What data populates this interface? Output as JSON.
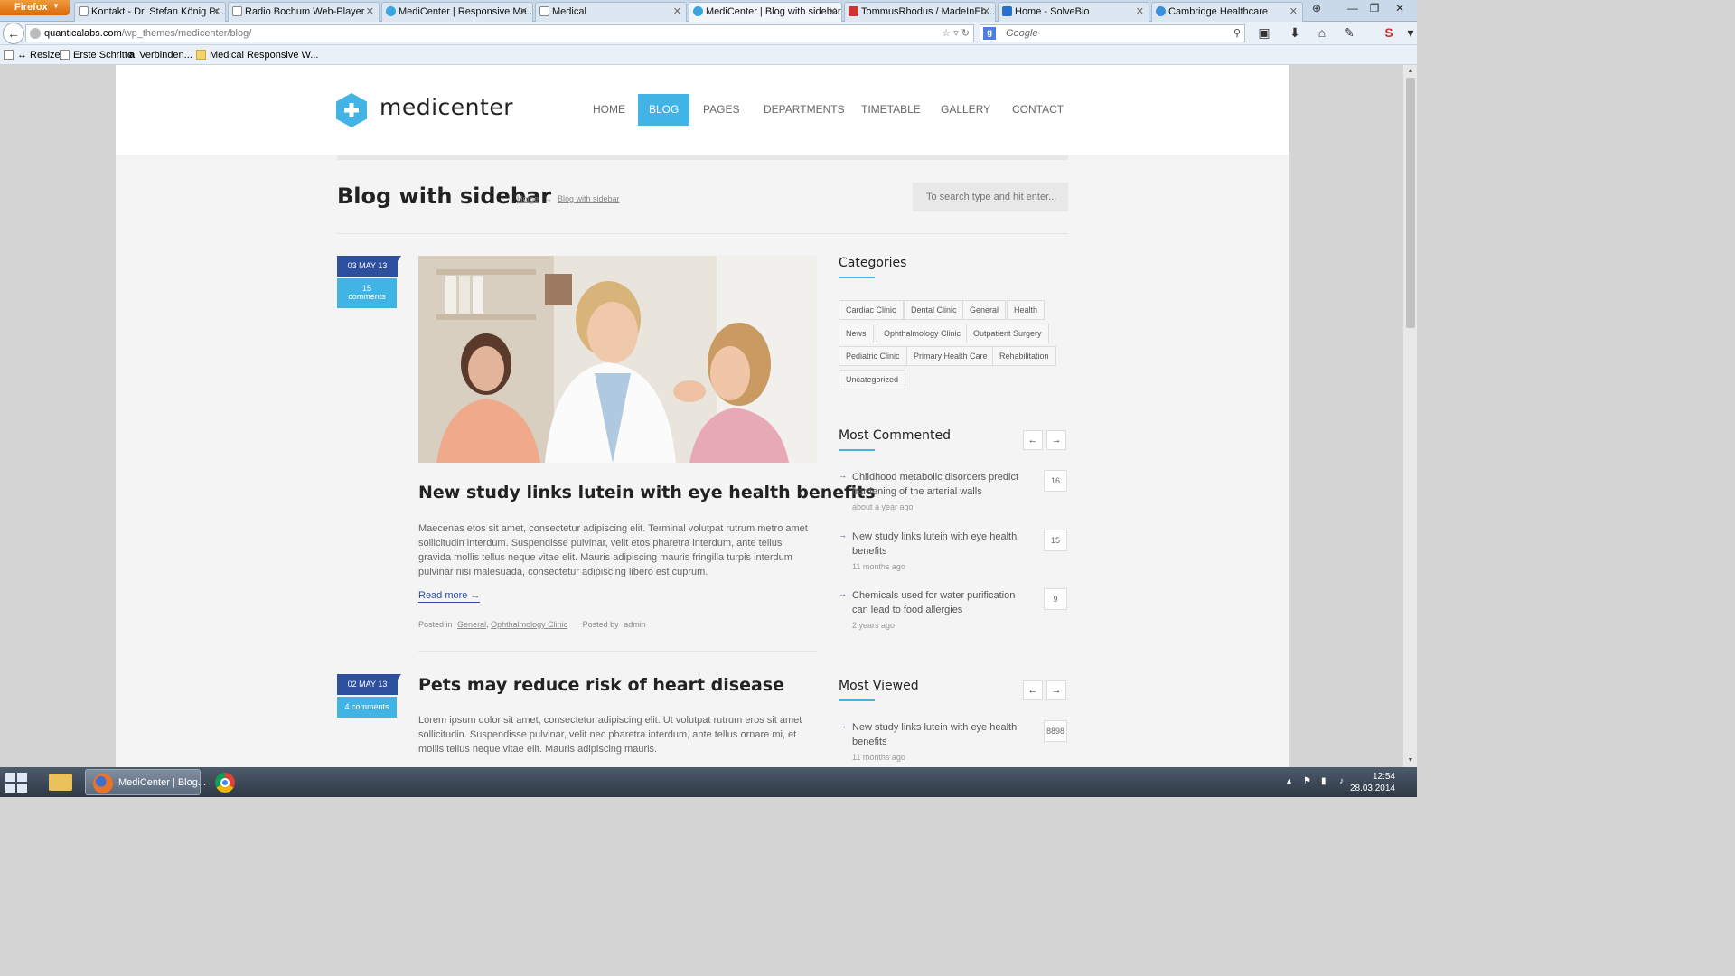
{
  "browser": {
    "menu_button": "Firefox",
    "tabs": [
      {
        "label": "Kontakt - Dr. Stefan König Pr..."
      },
      {
        "label": "Radio Bochum Web-Player"
      },
      {
        "label": "MediCenter | Responsive Me..."
      },
      {
        "label": "Medical"
      },
      {
        "label": "MediCenter | Blog with sidebar"
      },
      {
        "label": "TommusRhodus / MadeInEb..."
      },
      {
        "label": "Home - SolveBio"
      },
      {
        "label": "Cambridge Healthcare"
      }
    ],
    "active_tab_index": 4,
    "url_host": "quanticalabs.com",
    "url_path": "/wp_themes/medicenter/blog/",
    "search_placeholder": "Google",
    "bookmarks": [
      {
        "label": "↔ Resizer"
      },
      {
        "label": "Erste Schritte"
      },
      {
        "label": "Verbinden..."
      },
      {
        "label": "Medical Responsive W..."
      }
    ]
  },
  "site": {
    "logo_text": "medicenter",
    "menu": [
      {
        "label": "HOME",
        "active": false
      },
      {
        "label": "BLOG",
        "active": true
      },
      {
        "label": "PAGES",
        "active": false
      },
      {
        "label": "DEPARTMENTS",
        "active": false
      },
      {
        "label": "TIMETABLE",
        "active": false
      },
      {
        "label": "GALLERY",
        "active": false
      },
      {
        "label": "CONTACT",
        "active": false
      }
    ],
    "accent_color": "#42b3e5",
    "dark_accent_color": "#2e4f9e"
  },
  "page": {
    "title": "Blog with sidebar",
    "breadcrumb": {
      "home": "Home",
      "current": "Blog with sidebar"
    },
    "search_placeholder": "To search type and hit enter..."
  },
  "posts": [
    {
      "date": "03 MAY 13",
      "comments_count": "15",
      "comments_label": "comments",
      "title": "New study links lutein with eye health benefits",
      "excerpt": "Maecenas etos sit amet, consectetur adipiscing elit. Terminal volutpat rutrum metro amet sollicitudin interdum. Suspendisse pulvinar, velit etos pharetra interdum, ante tellus gravida mollis tellus neque vitae elit. Mauris adipiscing mauris fringilla turpis interdum pulvinar nisi malesuada, consectetur adipiscing libero est cuprum.",
      "read_more": "Read more →",
      "posted_in_label": "Posted in",
      "categories": [
        "General",
        "Ophthalmology Clinic"
      ],
      "posted_by_label": "Posted by",
      "author": "admin"
    },
    {
      "date": "02 MAY 13",
      "comments_text": "4 comments",
      "title": "Pets may reduce risk of heart disease",
      "excerpt": "Lorem ipsum dolor sit amet, consectetur adipiscing elit. Ut volutpat rutrum eros sit amet sollicitudin. Suspendisse pulvinar, velit nec pharetra interdum, ante tellus ornare mi, et mollis tellus neque vitae elit. Mauris adipiscing mauris."
    }
  ],
  "sidebar": {
    "categories_heading": "Categories",
    "categories": [
      "Cardiac Clinic",
      "Dental Clinic",
      "General",
      "Health",
      "News",
      "Ophthalmology Clinic",
      "Outpatient Surgery",
      "Pediatric Clinic",
      "Primary Health Care",
      "Rehabilitation",
      "Uncategorized"
    ],
    "most_commented_heading": "Most Commented",
    "most_commented": [
      {
        "title": "Childhood metabolic disorders predict hardening of the arterial walls",
        "date": "about a year ago",
        "count": "16"
      },
      {
        "title": "New study links lutein with eye health benefits",
        "date": "11 months ago",
        "count": "15"
      },
      {
        "title": "Chemicals used for water purification can lead to food allergies",
        "date": "2 years ago",
        "count": "9"
      }
    ],
    "most_viewed_heading": "Most Viewed",
    "most_viewed": [
      {
        "title": "New study links lutein with eye health benefits",
        "date": "11 months ago",
        "count": "8898"
      }
    ],
    "prev_arrow": "←",
    "next_arrow": "→"
  },
  "taskbar": {
    "active_app_label": "MediCenter | Blog...",
    "time": "12:54",
    "date": "28.03.2014"
  }
}
